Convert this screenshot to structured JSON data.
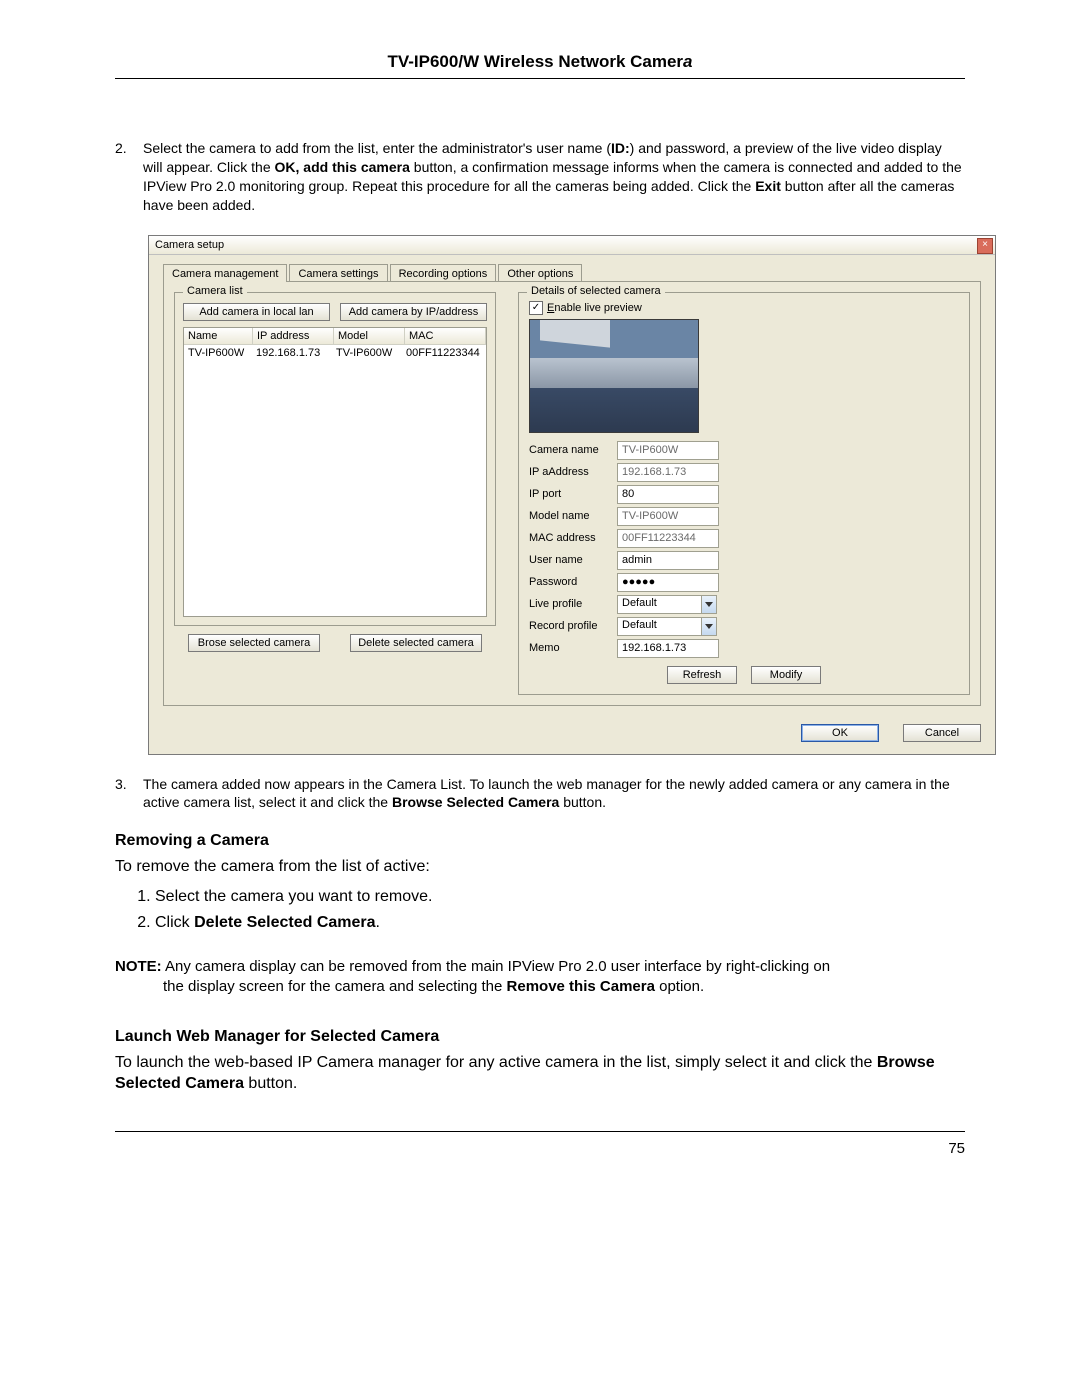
{
  "doc": {
    "title_prefix": "TV-IP600/W Wireless Network Camer",
    "title_italic": "a",
    "step2_num": "2.",
    "step2_p1a": "Select the camera to add from the list, enter the administrator's user name (",
    "step2_p1b": "ID:",
    "step2_p1c": ") and password, a preview of the live video display will appear. Click the ",
    "step2_p1d": "OK, add this camera",
    "step2_p1e": " button, a confirmation message informs when the camera is connected and added to the IPView Pro 2.0 monitoring group. Repeat this procedure for all the cameras being added. Click the ",
    "step2_p1f": "Exit",
    "step2_p1g": " button after all the cameras have been added.",
    "step3_num": "3.",
    "step3_a": "The camera added now appears in the Camera List. To launch the web manager for the newly added camera or any camera in the active camera list, select it and click the ",
    "step3_b": "Browse Selected Camera",
    "step3_c": " button.",
    "remove_h": "Removing a Camera",
    "remove_p": "To remove the camera from the list of active:",
    "remove_li1": "Select the camera you want to remove.",
    "remove_li2a": "Click ",
    "remove_li2b": "Delete Selected Camera",
    "remove_li2c": ".",
    "note_label": "NOTE:",
    "note_a": " Any camera display can be removed from the main IPView Pro 2.0 user interface by right-clicking on",
    "note_b": "the display screen for the camera and selecting the ",
    "note_c": "Remove this Camera",
    "note_d": " option.",
    "launch_h": "Launch Web Manager for Selected Camera",
    "launch_p_a": "To launch the web-based IP Camera manager for any active camera in the list, simply select it and click the ",
    "launch_p_b": "Browse Selected Camera",
    "launch_p_c": " button.",
    "page_number": "75"
  },
  "app": {
    "window_title": "Camera setup",
    "close_glyph": "×",
    "tabs": {
      "t0": "Camera management",
      "t1": "Camera settings",
      "t2": "Recording options",
      "t3": "Other options"
    },
    "camera_list_legend": "Camera list",
    "btn_add_local": "Add camera in local lan",
    "btn_add_ip": "Add camera by IP/address",
    "cols": {
      "name": "Name",
      "ip": "IP address",
      "model": "Model",
      "mac": "MAC"
    },
    "row": {
      "name": "TV-IP600W",
      "ip": "192.168.1.73",
      "model": "TV-IP600W",
      "mac": "00FF11223344"
    },
    "btn_browse": "Brose selected camera",
    "btn_delete": "Delete selected camera",
    "details_legend": "Details of selected camera",
    "chk_label": "Enable live preview",
    "fields": {
      "camera_name_l": "Camera name",
      "camera_name_v": "TV-IP600W",
      "ip_l": "IP aAddress",
      "ip_v": "192.168.1.73",
      "port_l": "IP port",
      "port_v": "80",
      "model_l": "Model name",
      "model_v": "TV-IP600W",
      "mac_l": "MAC address",
      "mac_v": "00FF11223344",
      "user_l": "User name",
      "user_v": "admin",
      "pass_l": "Password",
      "pass_v": "●●●●●",
      "live_l": "Live profile",
      "live_v": "Default",
      "rec_l": "Record profile",
      "rec_v": "Default",
      "memo_l": "Memo",
      "memo_v": "192.168.1.73"
    },
    "btn_refresh": "Refresh",
    "btn_modify": "Modify",
    "btn_ok": "OK",
    "btn_cancel": "Cancel"
  }
}
